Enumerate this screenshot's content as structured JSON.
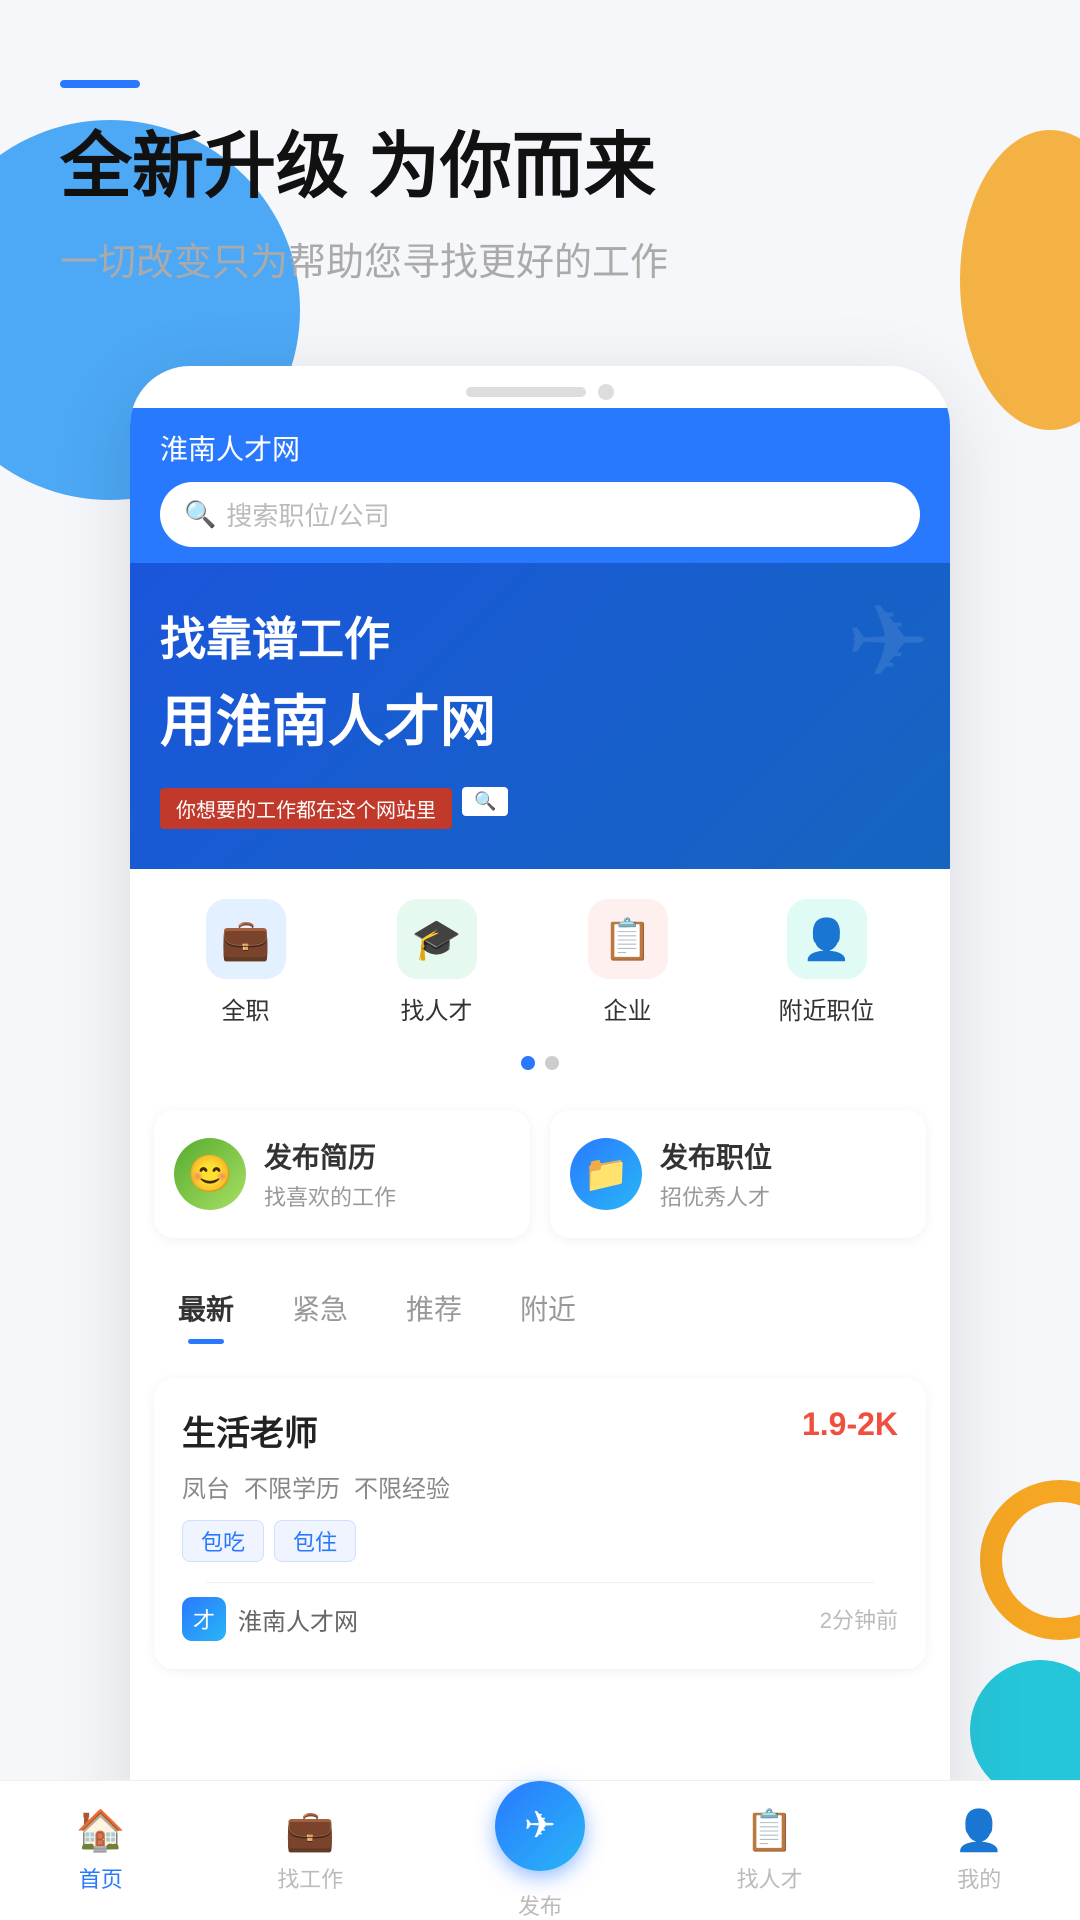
{
  "app": {
    "title": "淮南人才网"
  },
  "top": {
    "headline": "全新升级 为你而来",
    "subheadline": "一切改变只为帮助您寻找更好的工作"
  },
  "search": {
    "placeholder": "搜索职位/公司"
  },
  "banner": {
    "line1": "找靠谱工作",
    "line2": "用淮南人才网",
    "sub": "你想要的工作都在这个网站里"
  },
  "categories": [
    {
      "id": "fulltime",
      "label": "全职",
      "icon": "💼",
      "color": "cat-blue"
    },
    {
      "id": "talent",
      "label": "找人才",
      "icon": "🎓",
      "color": "cat-green"
    },
    {
      "id": "company",
      "label": "企业",
      "icon": "📋",
      "color": "cat-red"
    },
    {
      "id": "nearby",
      "label": "附近职位",
      "icon": "👤",
      "color": "cat-teal"
    }
  ],
  "actions": [
    {
      "id": "resume",
      "icon": "😊",
      "title": "发布简历",
      "subtitle": "找喜欢的工作",
      "color": "action-icon-green"
    },
    {
      "id": "job",
      "icon": "📁",
      "title": "发布职位",
      "subtitle": "招优秀人才",
      "color": "action-icon-blue"
    }
  ],
  "job_tabs": [
    {
      "id": "latest",
      "label": "最新",
      "active": true
    },
    {
      "id": "urgent",
      "label": "紧急",
      "active": false
    },
    {
      "id": "recommend",
      "label": "推荐",
      "active": false
    },
    {
      "id": "nearby",
      "label": "附近",
      "active": false
    }
  ],
  "job_card": {
    "title": "生活老师",
    "salary": "1.9-2K",
    "tags": [
      "凤台",
      "不限学历",
      "不限经验"
    ],
    "badges": [
      "包吃",
      "包住"
    ],
    "company": "淮南人才网",
    "post_time": "2分钟前"
  },
  "bottom_nav": [
    {
      "id": "home",
      "label": "首页",
      "icon": "🏠",
      "active": true
    },
    {
      "id": "find-job",
      "label": "找工作",
      "icon": "💼",
      "active": false
    },
    {
      "id": "publish",
      "label": "发布",
      "icon": "✈",
      "fab": true,
      "active": false
    },
    {
      "id": "find-talent",
      "label": "找人才",
      "icon": "📋",
      "active": false
    },
    {
      "id": "mine",
      "label": "我的",
      "icon": "👤",
      "active": false
    }
  ]
}
